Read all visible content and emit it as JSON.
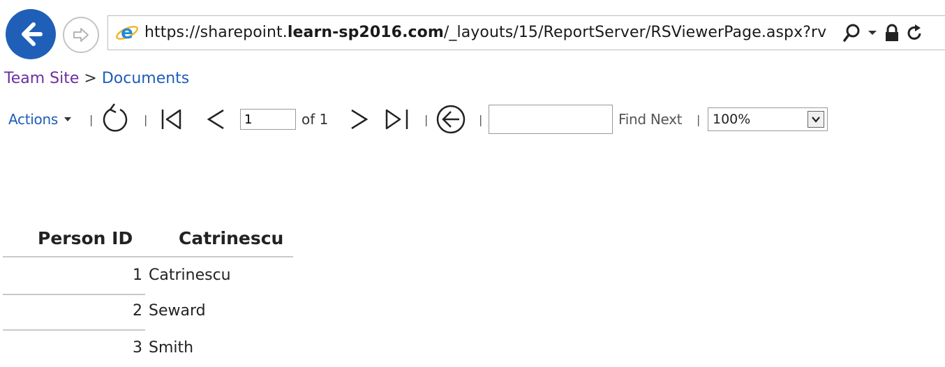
{
  "browser": {
    "url_prefix": "https://sharepoint.",
    "url_domain": "learn-sp2016.com",
    "url_path": "/_layouts/15/ReportServer/RSViewerPage.aspx?rv",
    "back_icon": "arrow-left-icon",
    "forward_icon": "arrow-right-icon",
    "address_icons": [
      "search-icon",
      "dropdown-icon",
      "lock-icon",
      "refresh-icon"
    ]
  },
  "breadcrumb": {
    "site": "Team Site",
    "separator": ">",
    "current": "Documents"
  },
  "toolbar": {
    "actions_label": "Actions",
    "separator": "|",
    "page_value": "1",
    "of_label": "of 1",
    "find_placeholder": "",
    "find_next_label": "Find Next",
    "zoom_value": "100%"
  },
  "report": {
    "columns": [
      "Person ID",
      "Catrinescu"
    ],
    "rows": [
      {
        "id": "1",
        "name": "Catrinescu"
      },
      {
        "id": "2",
        "name": "Seward"
      },
      {
        "id": "3",
        "name": "Smith"
      }
    ]
  },
  "colors": {
    "back_button": "#1f5fb8",
    "link_blue": "#1e5db7",
    "visited_purple": "#6b2fa0"
  }
}
